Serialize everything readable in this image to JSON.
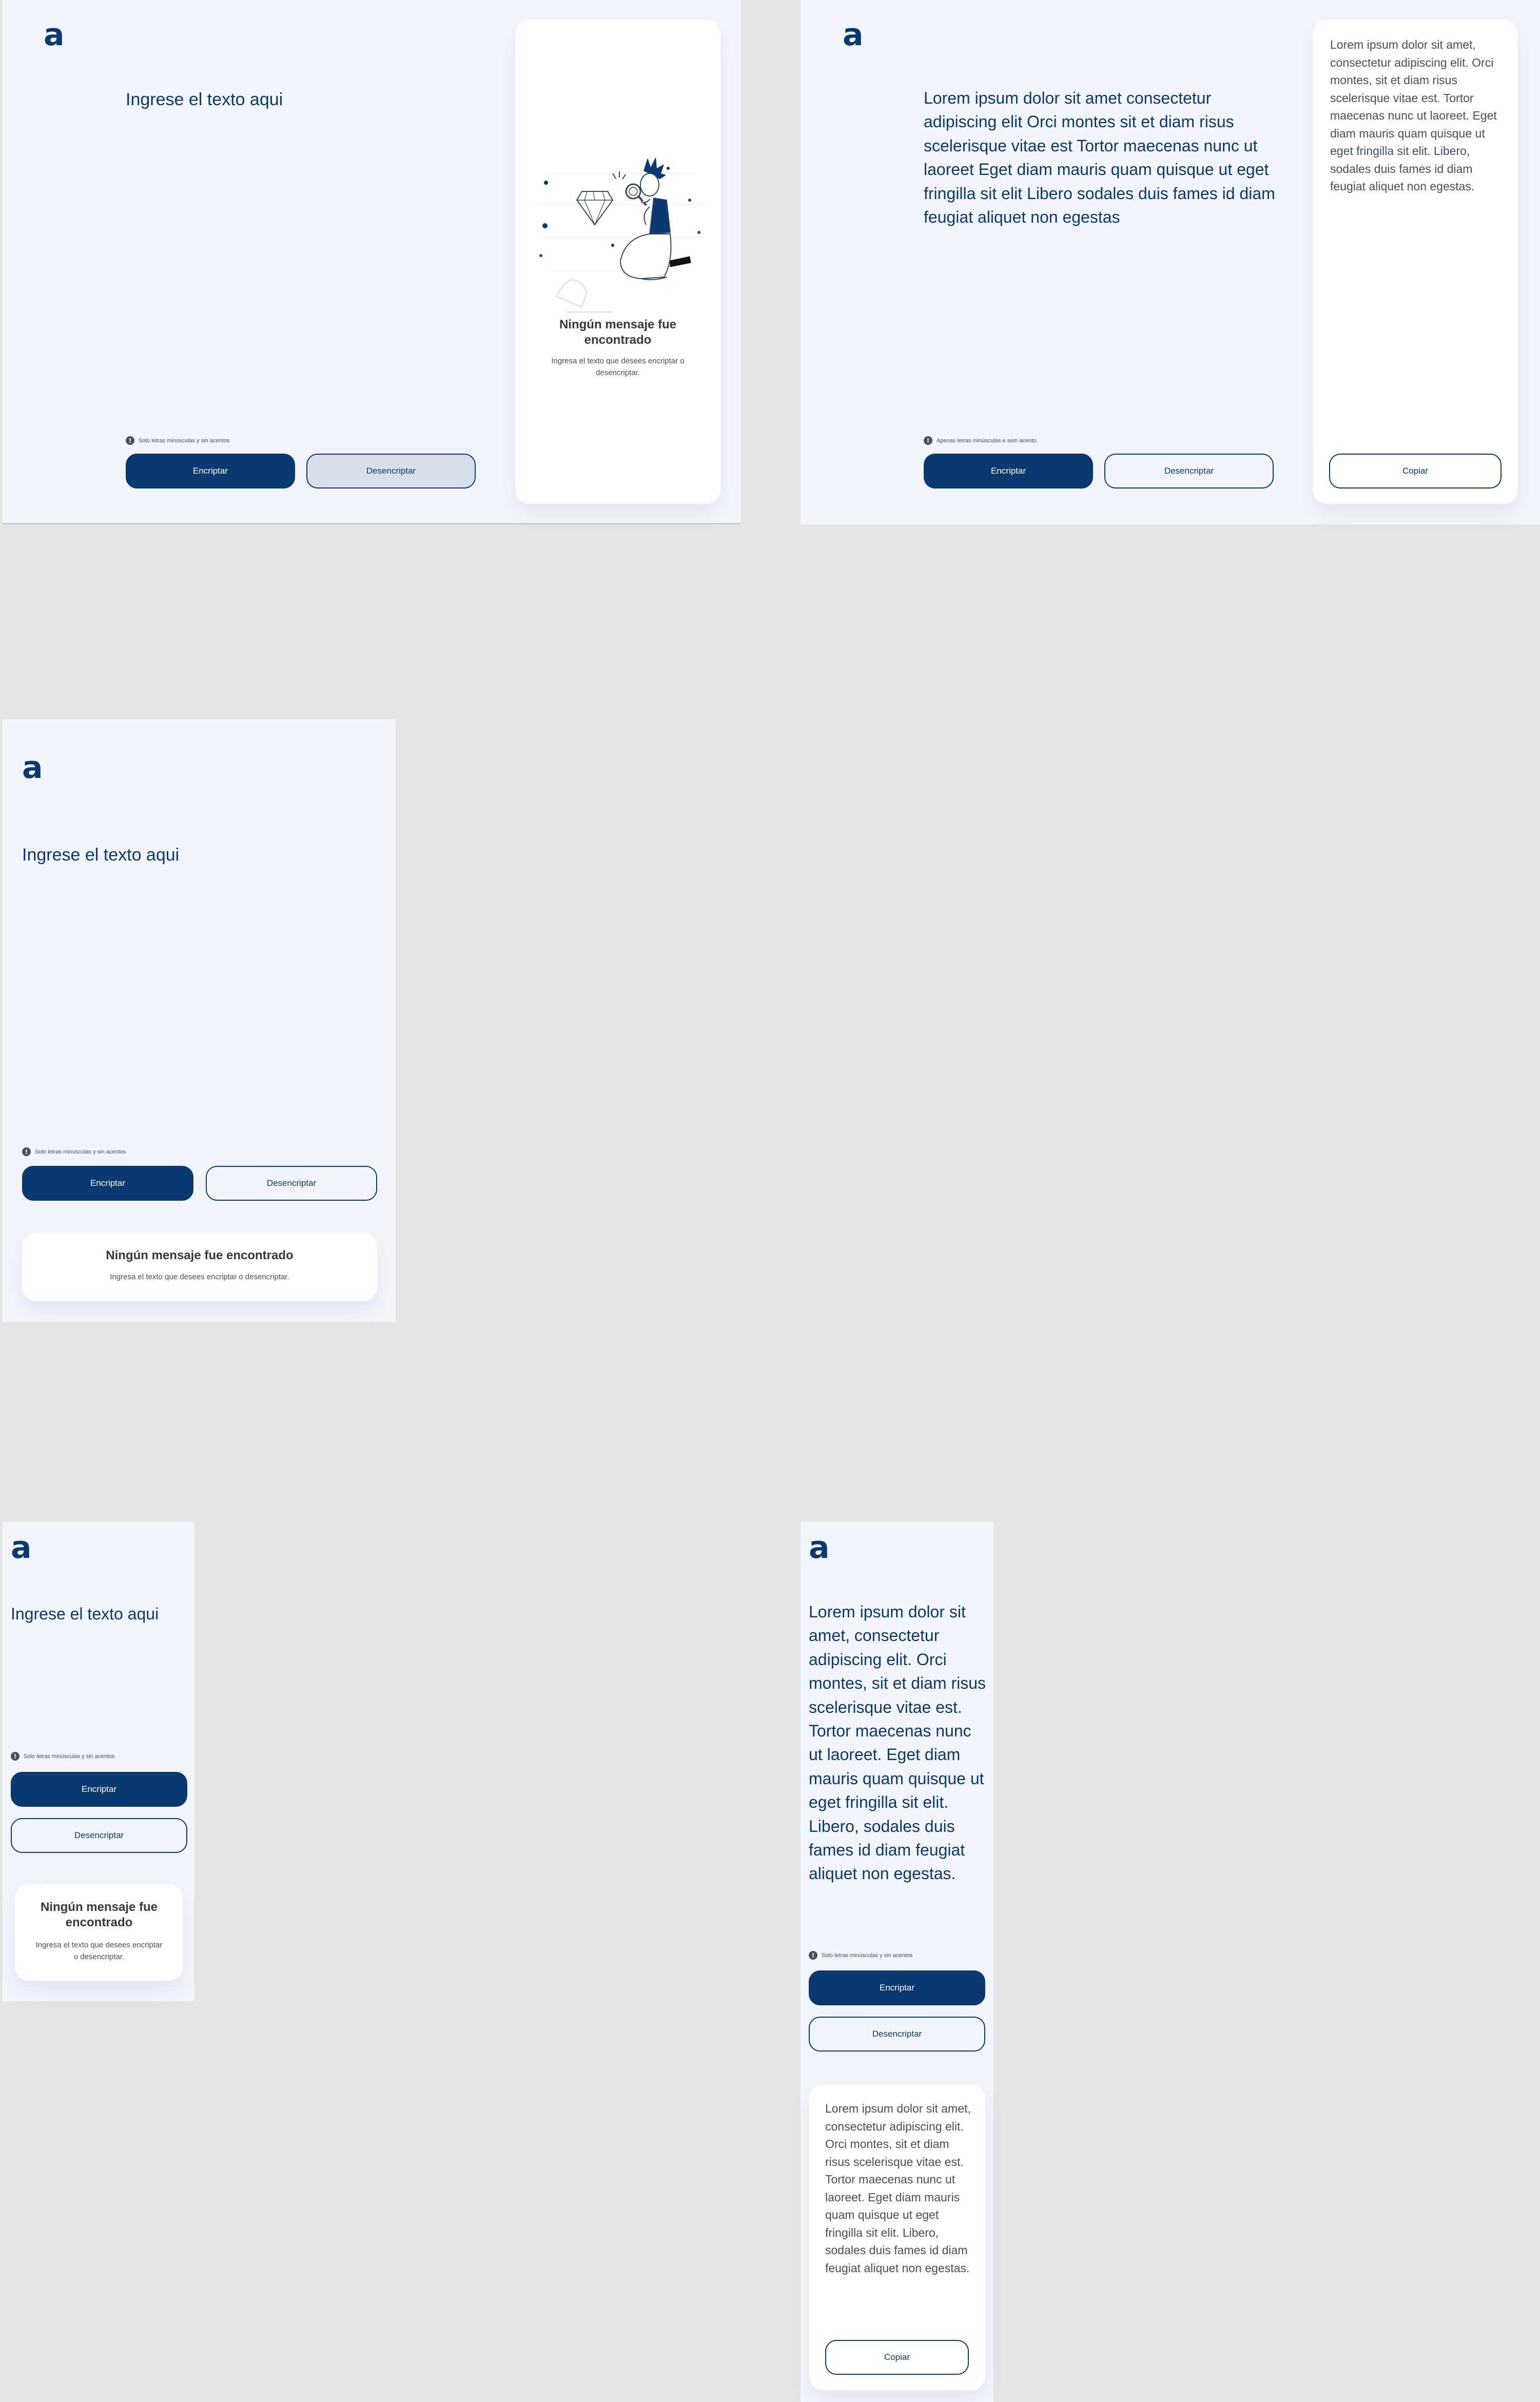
{
  "app": {
    "logo_glyph": "a",
    "colors": {
      "primary": "#0A3871",
      "background": "#F3F5FC",
      "canvas": "#E5E5E5",
      "text_gray": "#495057",
      "title_gray": "#343A40"
    }
  },
  "desktop_empty": {
    "input_placeholder": "Ingrese el texto aqui",
    "hint": "Solo letras minúsculas y sin acentos",
    "encrypt_label": "Encriptar",
    "decrypt_label": "Desencriptar",
    "empty_title": "Ningún mensaje fue encontrado",
    "empty_subtitle": "Ingresa el texto que desees encriptar o desencriptar.",
    "illustration_icon": "person-with-magnifier-and-diamond-illustration"
  },
  "desktop_filled": {
    "input_text": "Lorem ipsum dolor sit amet consectetur adipiscing elit Orci montes sit et diam risus scelerisque vitae est Tortor maecenas nunc ut laoreet Eget diam mauris quam quisque ut eget fringilla sit elit Libero sodales duis fames id diam feugiat aliquet non egestas",
    "hint": "Apenas letras minúsculas e sem acento.",
    "encrypt_label": "Encriptar",
    "decrypt_label": "Desencriptar",
    "output_text": "Lorem ipsum dolor sit amet, consectetur adipiscing elit. Orci montes, sit et diam risus scelerisque vitae est. Tortor maecenas nunc ut laoreet. Eget diam mauris quam quisque ut eget fringilla sit elit. Libero, sodales duis fames id diam feugiat aliquet non egestas.",
    "copy_label": "Copiar"
  },
  "tablet_empty": {
    "input_placeholder": "Ingrese el texto aqui",
    "hint": "Solo letras minúsculas y sin acentos",
    "encrypt_label": "Encriptar",
    "decrypt_label": "Desencriptar",
    "empty_title": "Ningún mensaje fue encontrado",
    "empty_subtitle": "Ingresa el texto que desees encriptar o desencriptar."
  },
  "mobile_empty": {
    "input_placeholder": "Ingrese el texto aqui",
    "hint": "Solo letras minúsculas y sin acentos",
    "encrypt_label": "Encriptar",
    "decrypt_label": "Desencriptar",
    "empty_title": "Ningún mensaje fue encontrado",
    "empty_subtitle": "Ingresa el texto que desees encriptar o desencriptar."
  },
  "mobile_filled": {
    "input_text": "Lorem ipsum dolor sit amet, consectetur adipiscing elit. Orci montes, sit et diam risus scelerisque vitae est. Tortor maecenas nunc ut laoreet. Eget diam mauris quam quisque ut eget fringilla sit elit. Libero, sodales duis fames id diam feugiat aliquet non egestas.",
    "hint": "Solo letras minúsculas y sin acentos",
    "encrypt_label": "Encriptar",
    "decrypt_label": "Desencriptar",
    "output_text": "Lorem ipsum dolor sit amet, consectetur adipiscing elit. Orci montes, sit et diam risus scelerisque vitae est. Tortor maecenas nunc ut laoreet. Eget diam mauris quam quisque ut eget fringilla sit elit. Libero, sodales duis fames id diam feugiat aliquet non egestas.",
    "copy_label": "Copiar"
  }
}
